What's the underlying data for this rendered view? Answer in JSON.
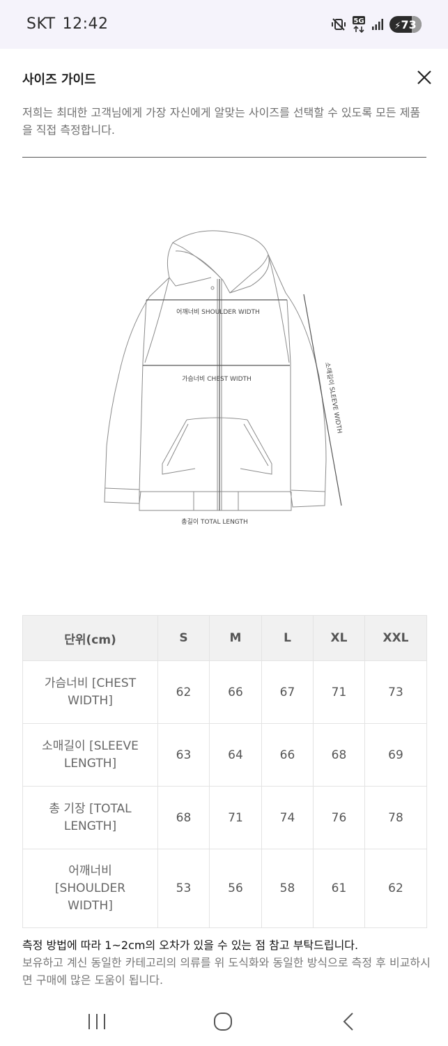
{
  "status_bar": {
    "carrier": "SKT",
    "time": "12:42",
    "network": "5G",
    "battery": "73",
    "icons": [
      "mute-vibrate-icon",
      "5g-data-icon",
      "signal-icon",
      "battery-charging-icon"
    ]
  },
  "header": {
    "title": "사이즈 가이드",
    "close_icon": "close-icon"
  },
  "description": "저희는 최대한 고객님에게 가장 자신에게 알맞는 사이즈를 선택할 수 있도록 모든 제품을 직접 측정합니다.",
  "diagram": {
    "shoulder_label": "어깨너비 SHOULDER WIDTH",
    "chest_label": "가슴너비 CHEST WIDTH",
    "sleeve_label": "소매길이 SLEEVE WIDTH",
    "total_label": "총길이 TOTAL LENGTH"
  },
  "table": {
    "headers": [
      "단위(cm)",
      "S",
      "M",
      "L",
      "XL",
      "XXL"
    ],
    "rows": [
      {
        "label": "가슴너비 [CHEST WIDTH]",
        "values": [
          "62",
          "66",
          "67",
          "71",
          "73"
        ]
      },
      {
        "label": "소매길이 [SLEEVE LENGTH]",
        "values": [
          "63",
          "64",
          "66",
          "68",
          "69"
        ]
      },
      {
        "label": "총 기장 [TOTAL LENGTH]",
        "values": [
          "68",
          "71",
          "74",
          "76",
          "78"
        ]
      },
      {
        "label": "어깨너비 [SHOULDER WIDTH]",
        "values": [
          "53",
          "56",
          "58",
          "61",
          "62"
        ]
      }
    ]
  },
  "notes": {
    "line1": "측정 방법에 따라 1~2cm의 오차가 있을 수 있는 점 참고 부탁드립니다.",
    "line2": "보유하고 계신 동일한 카테고리의 의류를 위 도식화와 동일한 방식으로 측정 후 비교하시면 구매에 많은 도움이 됩니다."
  },
  "nav_bar": {
    "buttons": [
      "recent-apps-icon",
      "home-icon",
      "back-icon"
    ]
  }
}
